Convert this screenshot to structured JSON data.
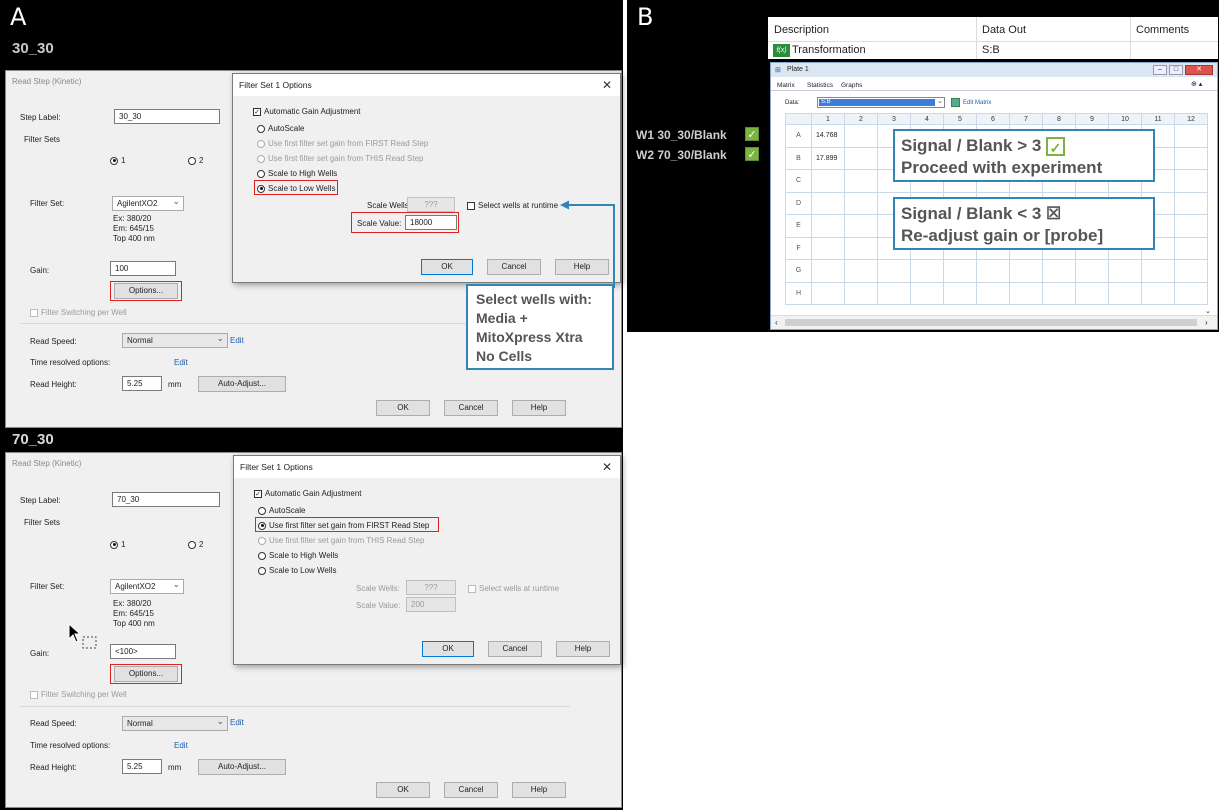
{
  "panel_a": {
    "tag": "A",
    "top": {
      "step_name": "30_30",
      "window_title": "Read Step (Kinetic)",
      "step_label_caption": "Step Label:",
      "step_label_value": "30_30",
      "filter_sets_caption": "Filter Sets",
      "radio1": "1",
      "radio2": "2",
      "filter_set_caption": "Filter Set:",
      "filter_set_value": "AgilentXO2",
      "filter_info": [
        "Ex: 380/20",
        "Em: 645/15",
        "Top 400 nm"
      ],
      "gain_caption": "Gain:",
      "gain_value": "100",
      "options_label": "Options...",
      "filter_switching": "Filter Switching per Well",
      "read_speed_caption": "Read Speed:",
      "read_speed_value": "Normal",
      "edit1": "Edit",
      "time_resolved": "Time resolved options:",
      "edit2": "Edit",
      "read_height_caption": "Read Height:",
      "read_height_value": "5.25",
      "read_height_unit": "mm",
      "auto_adjust": "Auto-Adjust...",
      "ok": "OK",
      "cancel": "Cancel",
      "help": "Help",
      "dialog": {
        "title": "Filter Set 1 Options",
        "auto_gain": "Automatic Gain Adjustment",
        "autoscale": "AutoScale",
        "first_read": "Use first filter set gain from FIRST Read Step",
        "this_read": "Use first filter set gain from THIS Read Step",
        "high_wells": "Scale to High Wells",
        "low_wells": "Scale to Low Wells",
        "scale_wells_caption": "Scale Wells:",
        "scale_wells_value": "???",
        "select_runtime": "Select wells at runtime",
        "scale_value_caption": "Scale Value:",
        "scale_value": "18000",
        "ok": "OK",
        "cancel": "Cancel",
        "help": "Help"
      },
      "callout": [
        "Select wells with:",
        "Media +",
        "MitoXpress Xtra",
        "No Cells"
      ]
    },
    "bottom": {
      "step_name": "70_30",
      "window_title": "Read Step (Kinetic)",
      "step_label_caption": "Step Label:",
      "step_label_value": "70_30",
      "filter_sets_caption": "Filter Sets",
      "radio1": "1",
      "radio2": "2",
      "filter_set_caption": "Filter Set:",
      "filter_set_value": "AgilentXO2",
      "filter_info": [
        "Ex: 380/20",
        "Em: 645/15",
        "Top 400 nm"
      ],
      "gain_caption": "Gain:",
      "gain_value": "<100>",
      "options_label": "Options...",
      "filter_switching": "Filter Switching per Well",
      "read_speed_caption": "Read Speed:",
      "read_speed_value": "Normal",
      "edit1": "Edit",
      "time_resolved": "Time resolved options:",
      "edit2": "Edit",
      "read_height_caption": "Read Height:",
      "read_height_value": "5.25",
      "read_height_unit": "mm",
      "auto_adjust": "Auto-Adjust...",
      "ok": "OK",
      "cancel": "Cancel",
      "help": "Help",
      "dialog": {
        "title": "Filter Set 1 Options",
        "auto_gain": "Automatic Gain Adjustment",
        "autoscale": "AutoScale",
        "first_read": "Use first filter set gain from FIRST Read Step",
        "this_read": "Use first filter set gain from THIS Read Step",
        "high_wells": "Scale to High Wells",
        "low_wells": "Scale to Low Wells",
        "scale_wells_caption": "Scale Wells:",
        "scale_wells_value": "???",
        "select_runtime": "Select wells at runtime",
        "scale_value_caption": "Scale Value:",
        "scale_value": "200",
        "ok": "OK",
        "cancel": "Cancel",
        "help": "Help"
      }
    }
  },
  "panel_b": {
    "tag": "B",
    "header": {
      "description": "Description",
      "data_out": "Data Out",
      "comments": "Comments"
    },
    "row": {
      "icon": "f(x)",
      "name": "Transformation",
      "data_out": "S:B"
    },
    "plate": {
      "title": "Plate 1",
      "tabs": [
        "Matrix",
        "Statistics",
        "Graphs"
      ],
      "data_caption": "Data:",
      "data_value": "S:B",
      "edit_matrix": "Edit Matrix",
      "columns": [
        "1",
        "2",
        "3",
        "4",
        "5",
        "6",
        "7",
        "8",
        "9",
        "10",
        "11",
        "12"
      ],
      "rows": [
        "A",
        "B",
        "C",
        "D",
        "E",
        "F",
        "G",
        "H"
      ],
      "values": {
        "A1": "14.768",
        "B1": "17.899"
      }
    },
    "left_labels": [
      "W1 30_30/Blank",
      "W2 70_30/Blank"
    ],
    "box_pass": {
      "line1": "Signal / Blank > 3",
      "line2": "Proceed with experiment"
    },
    "box_fail": {
      "line1": "Signal / Blank < 3 ☒",
      "line2": "Re-adjust gain or [probe]"
    }
  },
  "colors": {
    "callout_border": "#2f86b7",
    "red_highlight": "#dd2222",
    "check_green": "#7cb342"
  }
}
